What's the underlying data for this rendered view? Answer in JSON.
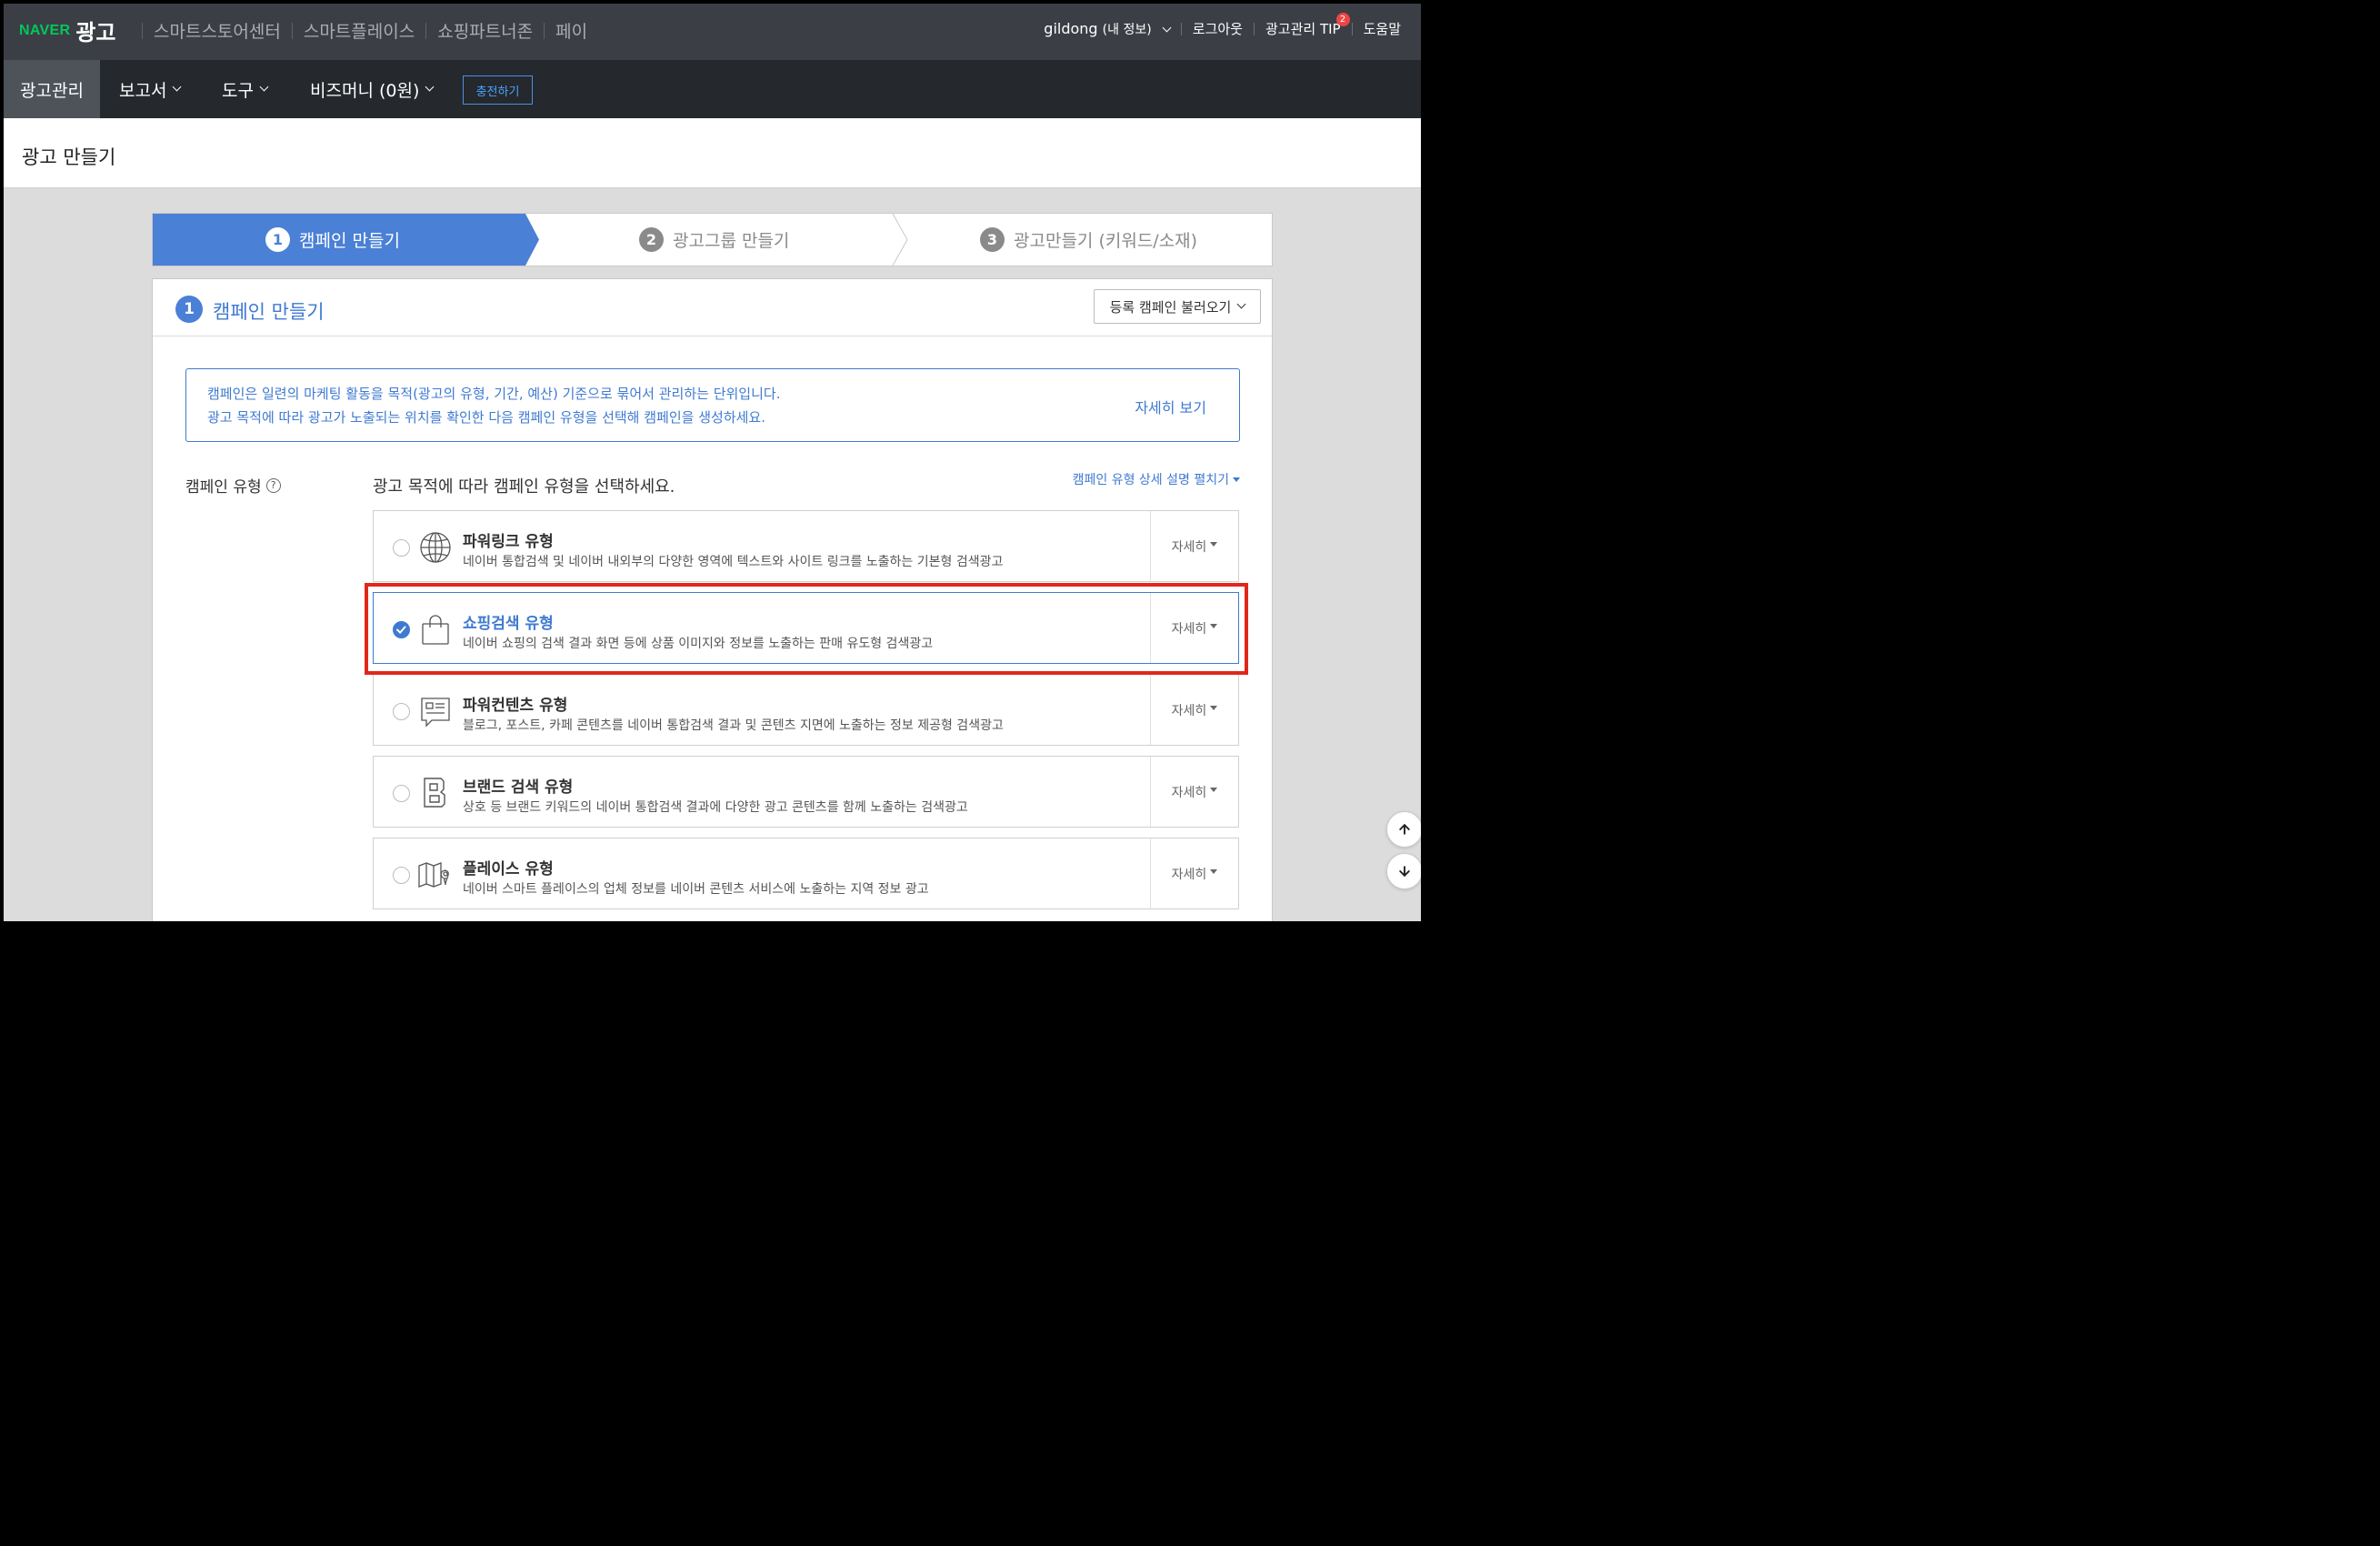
{
  "top": {
    "logo_naver": "NAVER",
    "logo_product": "광고",
    "nav": [
      "스마트스토어센터",
      "스마트플레이스",
      "쇼핑파트너존",
      "페이"
    ],
    "user_name": "gildong",
    "user_info": "(내 정보)",
    "logout": "로그아웃",
    "tip": "광고관리 TIP",
    "tip_badge": "2",
    "help": "도움말"
  },
  "menu": {
    "manage": "광고관리",
    "reports": "보고서",
    "tools": "도구",
    "bizmoney": "비즈머니 (0원)",
    "charge": "충전하기"
  },
  "page_title": "광고 만들기",
  "steps": [
    {
      "num": "1",
      "label": "캠페인 만들기"
    },
    {
      "num": "2",
      "label": "광고그룹 만들기"
    },
    {
      "num": "3",
      "label": "광고만들기 (키워드/소재)"
    }
  ],
  "panel": {
    "num": "1",
    "title": "캠페인 만들기",
    "load_button": "등록 캠페인 불러오기",
    "info_line1": "캠페인은 일련의 마케팅 활동을 목적(광고의 유형, 기간, 예산) 기준으로 묶어서 관리하는 단위입니다.",
    "info_line2": "광고 목적에 따라 광고가 노출되는 위치를 확인한 다음 캠페인 유형을 선택해 캠페인을 생성하세요.",
    "info_more": "자세히 보기",
    "type_label": "캠페인 유형",
    "guide": "광고 목적에 따라 캠페인 유형을 선택하세요.",
    "expand": "캠페인 유형 상세 설명 펼치기",
    "detail_label": "자세히"
  },
  "campaign_types": [
    {
      "name": "파워링크 유형",
      "desc": "네이버 통합검색 및 네이버 내외부의 다양한 영역에 텍스트와 사이트 링크를 노출하는 기본형 검색광고",
      "icon": "globe-icon",
      "selected": false
    },
    {
      "name": "쇼핑검색 유형",
      "desc": "네이버 쇼핑의 검색 결과 화면 등에 상품 이미지와 정보를 노출하는 판매 유도형 검색광고",
      "icon": "shopping-bag-icon",
      "selected": true
    },
    {
      "name": "파워컨텐츠 유형",
      "desc": "블로그, 포스트, 카페 콘텐츠를 네이버 통합검색 결과 및 콘텐츠 지면에 노출하는 정보 제공형 검색광고",
      "icon": "content-bubble-icon",
      "selected": false
    },
    {
      "name": "브랜드 검색 유형",
      "desc": "상호 등 브랜드 키워드의 네이버 통합검색 결과에 다양한 광고 콘텐츠를 함께 노출하는 검색광고",
      "icon": "brand-b-icon",
      "selected": false
    },
    {
      "name": "플레이스 유형",
      "desc": "네이버 스마트 플레이스의 업체 정보를 네이버 콘텐츠 서비스에 노출하는 지역 정보 광고",
      "icon": "map-pin-icon",
      "selected": false
    }
  ],
  "colors": {
    "accent": "#3f7ad1",
    "step_active": "#4a80d6",
    "naver_green": "#03c75a",
    "highlight": "#e0271b",
    "topbar": "#3b3f45",
    "menubar": "#25282c"
  }
}
